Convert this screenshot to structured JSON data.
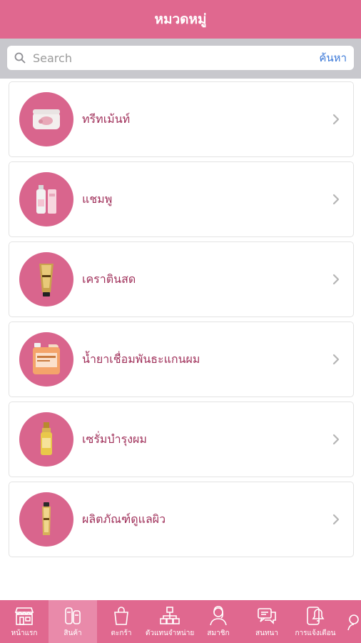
{
  "header": {
    "title": "หมวดหมู่"
  },
  "search": {
    "placeholder": "Search",
    "button_label": "ค้นหา"
  },
  "categories": [
    {
      "label": "ทรีทเม้นท์",
      "icon": "treatment-jar-icon"
    },
    {
      "label": "แชมพู",
      "icon": "shampoo-bottle-icon"
    },
    {
      "label": "เคราตินสด",
      "icon": "keratin-tube-icon"
    },
    {
      "label": "น้ำยาเชื่อมพันธะแกนผม",
      "icon": "gallon-container-icon"
    },
    {
      "label": "เซรั่มบำรุงผม",
      "icon": "serum-spray-icon"
    },
    {
      "label": "ผลิตภัณฑ์ดูแลผิว",
      "icon": "skincare-tube-icon"
    }
  ],
  "tabbar": {
    "active_index": 1,
    "items": [
      {
        "label": "หน้าแรก",
        "icon": "storefront-icon"
      },
      {
        "label": "สินค้า",
        "icon": "products-icon"
      },
      {
        "label": "ตะกร้า",
        "icon": "shopping-bag-icon"
      },
      {
        "label": "ตัวแทนจำหน่าย",
        "icon": "network-icon"
      },
      {
        "label": "สมาชิก",
        "icon": "member-icon"
      },
      {
        "label": "สนทนา",
        "icon": "chat-icon"
      },
      {
        "label": "การแจ้งเตือน",
        "icon": "notification-icon"
      }
    ]
  },
  "colors": {
    "brand_pink": "#e0688f",
    "thumb_pink": "#d9658d",
    "label_text": "#a0305a",
    "search_link": "#3a78d8"
  }
}
